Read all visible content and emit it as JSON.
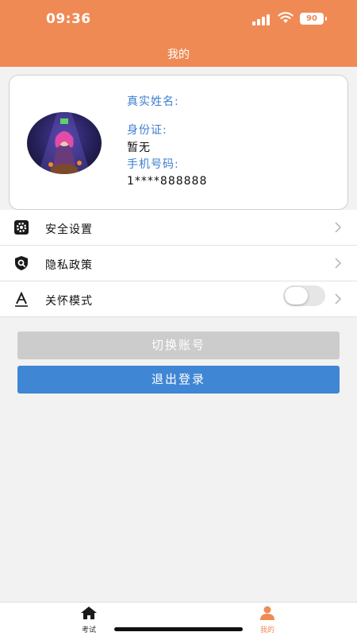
{
  "status_bar": {
    "time": "09:36",
    "battery": "90"
  },
  "header": {
    "title": "我的"
  },
  "profile": {
    "real_name_label": "真实姓名:",
    "real_name_value": "",
    "id_label": "身份证:",
    "id_value": "暂无",
    "phone_label": "手机号码:",
    "phone_value": "1****888888"
  },
  "menu": {
    "items": [
      {
        "label": "安全设置",
        "icon": "gear-icon"
      },
      {
        "label": "隐私政策",
        "icon": "privacy-shield-icon"
      },
      {
        "label": "关怀模式",
        "icon": "font-size-icon",
        "toggle_on": false
      }
    ]
  },
  "buttons": {
    "switch_account": "切换账号",
    "logout": "退出登录"
  },
  "tabbar": {
    "tabs": [
      {
        "label": "考试",
        "icon": "home-icon",
        "active": false
      },
      {
        "label": "我的",
        "icon": "user-icon",
        "active": true
      }
    ]
  },
  "colors": {
    "header": "#ef8a55",
    "label_blue": "#3d7fd0",
    "logout_button": "#3f86d4",
    "switch_button": "#cccccc",
    "tab_active": "#ef8a55"
  }
}
